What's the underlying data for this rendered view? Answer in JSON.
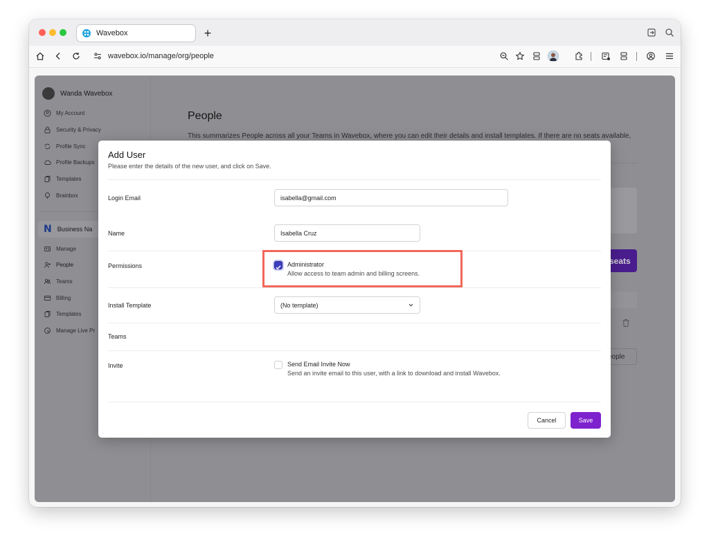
{
  "browser": {
    "tab_title": "Wavebox",
    "new_tab_symbol": "+",
    "url": "wavebox.io/manage/org/people"
  },
  "sidebar": {
    "user_name": "Wanda Wavebox",
    "account_items": [
      {
        "label": "My Account",
        "icon": "user-circle-icon"
      },
      {
        "label": "Security & Privacy",
        "icon": "lock-icon"
      },
      {
        "label": "Profile Sync",
        "icon": "sync-icon"
      },
      {
        "label": "Profile Backups",
        "icon": "cloud-icon"
      },
      {
        "label": "Templates",
        "icon": "templates-icon"
      },
      {
        "label": "Brainbox",
        "icon": "lightbulb-icon"
      }
    ],
    "business_name": "Business Na",
    "business_items": [
      {
        "label": "Manage",
        "icon": "id-card-icon"
      },
      {
        "label": "People",
        "icon": "user-plus-icon"
      },
      {
        "label": "Teams",
        "icon": "users-icon"
      },
      {
        "label": "Billing",
        "icon": "credit-card-icon"
      },
      {
        "label": "Templates",
        "icon": "templates-icon"
      },
      {
        "label": "Manage Live Pr",
        "icon": "pointer-icon"
      }
    ]
  },
  "main": {
    "title": "People",
    "description": "This summarizes People across all your Teams in Wavebox, where you can edit their details and install templates. If there are no seats available,",
    "seats_button_partial": "seats",
    "people_button_partial": "eople"
  },
  "modal": {
    "title": "Add User",
    "subtitle": "Please enter the details of the new user, and click on Save.",
    "fields": {
      "login_email_label": "Login Email",
      "login_email_value": "isabella@gmail.com",
      "name_label": "Name",
      "name_value": "Isabella Cruz",
      "permissions_label": "Permissions",
      "admin_title": "Administrator",
      "admin_desc": "Allow access to team admin and billing screens.",
      "admin_checked": true,
      "template_label": "Install Template",
      "template_value": "(No template)",
      "teams_label": "Teams",
      "invite_label": "Invite",
      "invite_title": "Send Email Invite Now",
      "invite_desc": "Send an invite email to this user, with a link to download and install Wavebox.",
      "invite_checked": false
    },
    "cancel_label": "Cancel",
    "save_label": "Save"
  },
  "colors": {
    "accent": "#7e22ce",
    "highlight_box": "#f2675a",
    "checkbox": "#3e3ec0"
  }
}
